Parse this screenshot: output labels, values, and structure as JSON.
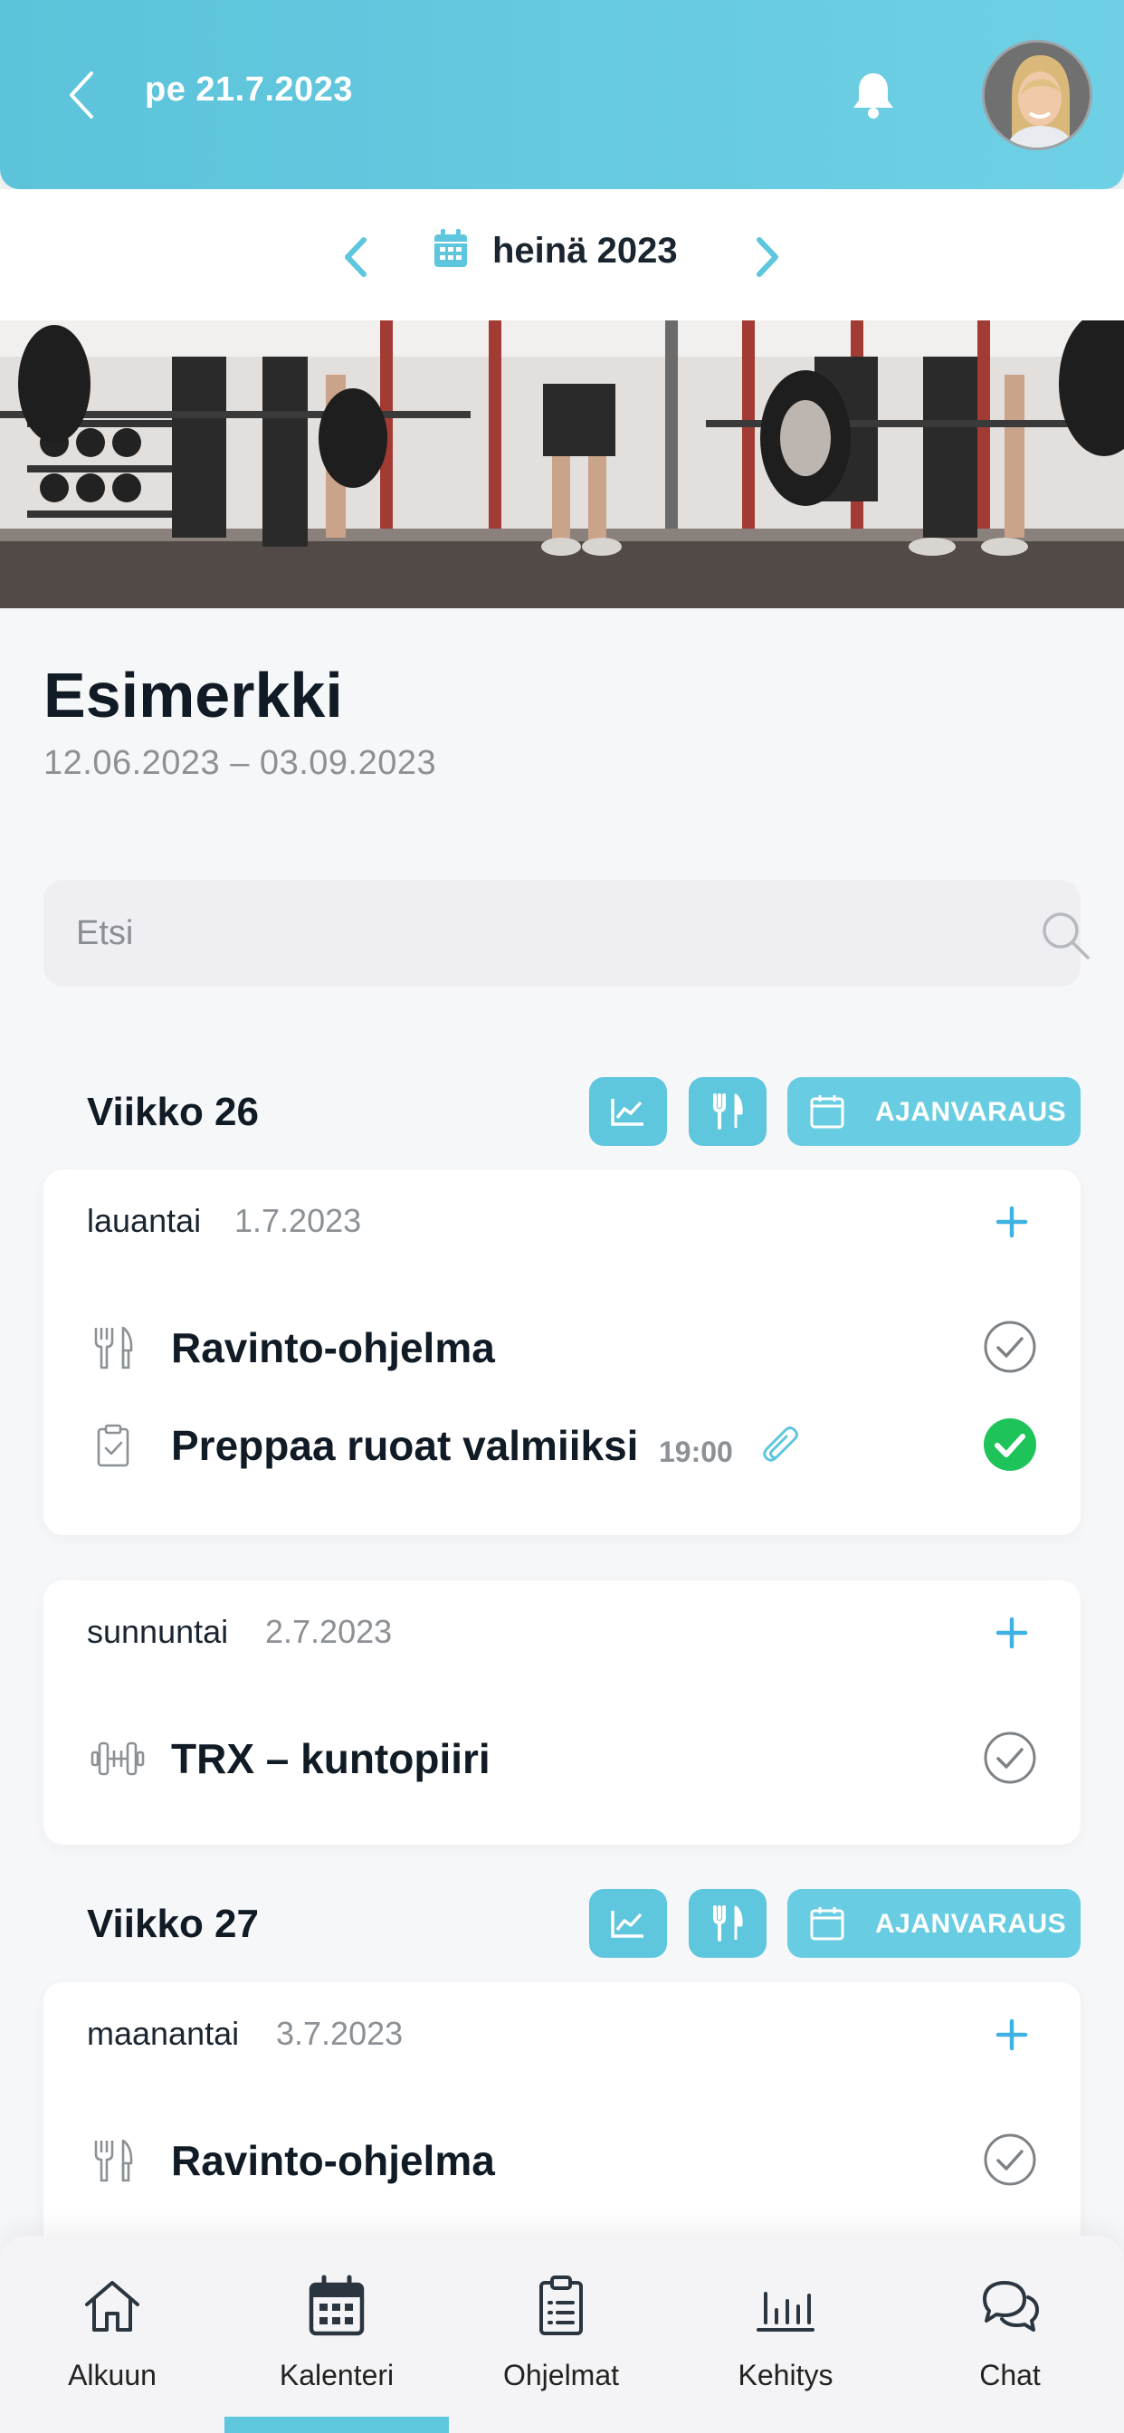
{
  "header": {
    "date": "pe 21.7.2023"
  },
  "month_nav": {
    "label": "heinä 2023"
  },
  "program": {
    "title": "Esimerkki",
    "dates": "12.06.2023 – 03.09.2023"
  },
  "search": {
    "placeholder": "Etsi"
  },
  "colors": {
    "accent": "#5ec6dd",
    "done": "#1ec45a"
  },
  "booking_label": "AJANVARAUS",
  "weeks": [
    {
      "title": "Viikko 26",
      "days": [
        {
          "name": "lauantai",
          "date": "1.7.2023",
          "items": [
            {
              "icon": "fork-knife-icon",
              "title": "Ravinto-ohjelma",
              "done": false
            },
            {
              "icon": "clipboard-check-icon",
              "title": "Preppaa ruoat valmiiksi",
              "time": "19:00",
              "attachment": true,
              "done": true
            }
          ]
        },
        {
          "name": "sunnuntai",
          "date": "2.7.2023",
          "items": [
            {
              "icon": "dumbbell-icon",
              "title": "TRX – kuntopiiri",
              "done": false
            }
          ]
        }
      ]
    },
    {
      "title": "Viikko 27",
      "days": [
        {
          "name": "maanantai",
          "date": "3.7.2023",
          "items": [
            {
              "icon": "fork-knife-icon",
              "title": "Ravinto-ohjelma",
              "done": false
            }
          ]
        }
      ]
    }
  ],
  "bottom_nav": [
    {
      "label": "Alkuun",
      "icon": "home-icon"
    },
    {
      "label": "Kalenteri",
      "icon": "calendar-icon",
      "active": true
    },
    {
      "label": "Ohjelmat",
      "icon": "clipboard-list-icon"
    },
    {
      "label": "Kehitys",
      "icon": "bar-chart-icon"
    },
    {
      "label": "Chat",
      "icon": "chat-bubbles-icon"
    }
  ]
}
